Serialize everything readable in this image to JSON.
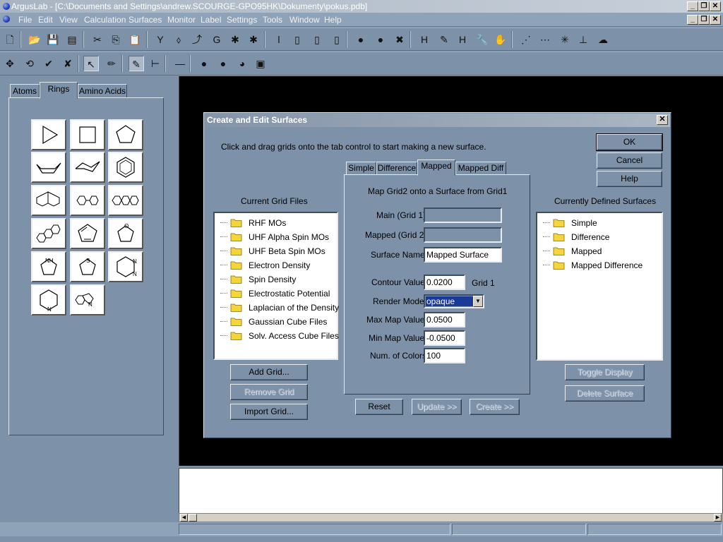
{
  "window": {
    "title": "ArgusLab - [C:\\Documents and Settings\\andrew.SCOURGE-GPO95HK\\Dokumenty\\pokus.pdb]",
    "controls": [
      "_",
      "❐",
      "✕"
    ]
  },
  "menu": [
    "File",
    "Edit",
    "View",
    "Calculation",
    "Surfaces",
    "Monitor",
    "Label",
    "Settings",
    "Tools",
    "Window",
    "Help"
  ],
  "toolbar1": {
    "icons": [
      "new-file-icon",
      "open-folder-icon",
      "save-icon",
      "list-icon",
      "cut-icon",
      "copy-icon",
      "paste-icon",
      "atom-add-icon",
      "atom-tool-icon",
      "bond-tool-icon",
      "g-icon",
      "molecule-color-icon",
      "molecule-color2-icon",
      "pencil-red-icon",
      "tube-red-icon",
      "tube-yellow-icon",
      "tube-green-icon",
      "sphere-icon",
      "ion-icon",
      "star-icon",
      "h-label-icon",
      "h-edit-icon",
      "h-remove-icon",
      "wrench-icon",
      "hand-icon",
      "chain-icon",
      "bracket-icon",
      "network-icon",
      "axes-icon",
      "cluster-icon"
    ],
    "glyphs": [
      "🗋",
      "📂",
      "💾",
      "▤",
      "✂",
      "⎘",
      "📋",
      "Y",
      "⬨",
      "⤴",
      "G",
      "✱",
      "✱",
      "ǀ",
      "▯",
      "▯",
      "▯",
      "●",
      "●",
      "✖",
      "H",
      "✎",
      "H",
      "🔧",
      "✋",
      "⋰",
      "⋯",
      "✳",
      "⊥",
      "☁"
    ]
  },
  "toolbar2": {
    "icons": [
      "move-icon",
      "rotate-icon",
      "select-ok-icon",
      "select-x-icon",
      "arrow-select-icon",
      "pencil-icon",
      "draw-bond-icon",
      "fragment-icon",
      "minus-icon",
      "red-sphere-icon",
      "red-sphere2-icon",
      "color-ball-icon",
      "box-icon"
    ],
    "glyphs": [
      "✥",
      "⟲",
      "✔",
      "✘",
      "↖",
      "✏",
      "✎",
      "⊢",
      "—",
      "●",
      "●",
      "◕",
      "▣"
    ]
  },
  "left_tabs": [
    "Atoms",
    "Rings",
    "Amino Acids"
  ],
  "left_active_tab": "Rings",
  "rings": [
    "cyclopropane",
    "cyclobutane",
    "cyclopentane",
    "cyclohexane-boat",
    "cyclohexane-chair",
    "benzene",
    "naphthalene",
    "biphenyl",
    "anthracene",
    "phenanthrene",
    "cyclopentadiene",
    "furan",
    "pyrrole",
    "thiophene",
    "pyrimidine",
    "pyridine",
    "indole"
  ],
  "ring_labels": {
    "furan": "O",
    "pyrrole": "NH",
    "thiophene": "S",
    "pyrimidine_n1": "N",
    "pyrimidine_n2": "N",
    "pyridine": "N",
    "indole": "N"
  },
  "dialog": {
    "title": "Create and Edit Surfaces",
    "close": "✕",
    "instructions": "Click and drag grids onto the tab control to start making a new surface.",
    "ok": "OK",
    "cancel": "Cancel",
    "help": "Help",
    "grid_files_header": "Current Grid Files",
    "grid_files": [
      "RHF MOs",
      "UHF Alpha Spin MOs",
      "UHF Beta Spin MOs",
      "Electron Density",
      "Spin Density",
      "Electrostatic Potential",
      "Laplacian of the Density",
      "Gaussian Cube Files",
      "Solv. Access Cube Files"
    ],
    "add_grid": "Add Grid...",
    "remove_grid": "Remove Grid",
    "import_grid": "Import Grid...",
    "tabs": [
      "Simple",
      "Difference",
      "Mapped",
      "Mapped Diff"
    ],
    "active_tab": "Mapped",
    "tab_heading": "Map Grid2 onto a Surface from Grid1",
    "main_grid_label": "Main (Grid 1)",
    "main_grid_value": "",
    "mapped_grid_label": "Mapped (Grid 2)",
    "mapped_grid_value": "",
    "surface_name_label": "Surface Name",
    "surface_name_value": "Mapped Surface",
    "contour_label": "Contour Value",
    "contour_value": "0.0200",
    "contour_unit": "Grid 1",
    "render_mode_label": "Render Mode",
    "render_mode_value": "opaque",
    "max_map_label": "Max Map Value",
    "max_map_value": "0.0500",
    "min_map_label": "Min Map Value",
    "min_map_value": "-0.0500",
    "num_colors_label": "Num. of Colors",
    "num_colors_value": "100",
    "reset": "Reset",
    "update": "Update >>",
    "create": "Create >>",
    "surfaces_header": "Currently Defined Surfaces",
    "surfaces": [
      "Simple",
      "Difference",
      "Mapped",
      "Mapped Difference"
    ],
    "toggle_display": "Toggle Display",
    "delete_surface": "Delete Surface"
  },
  "colors": {
    "desktop": "#7d91a8",
    "viewport": "#000000",
    "folder": "#f4d53c"
  }
}
